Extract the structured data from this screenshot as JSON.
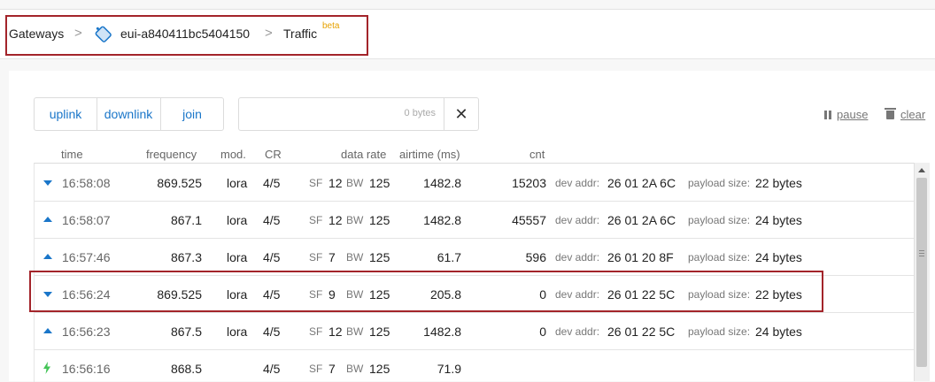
{
  "breadcrumb": {
    "gateways": "Gateways",
    "gateway_id": "eui-a840411bc5404150",
    "traffic": "Traffic",
    "beta": "beta",
    "separator": ">"
  },
  "filters": {
    "uplink": "uplink",
    "downlink": "downlink",
    "join": "join",
    "payload_size": "0 bytes",
    "close": "✕"
  },
  "actions": {
    "pause": "pause",
    "clear": "clear"
  },
  "columns": {
    "time": "time",
    "frequency": "frequency",
    "mod": "mod.",
    "cr": "CR",
    "data_rate": "data rate",
    "airtime": "airtime (ms)",
    "cnt": "cnt"
  },
  "labels": {
    "sf": "SF",
    "bw": "BW",
    "dev_addr": "dev addr:",
    "payload_size": "payload size:"
  },
  "rows": [
    {
      "direction": "downlink",
      "time": "16:58:08",
      "frequency": "869.525",
      "mod": "lora",
      "cr": "4/5",
      "sf": "12",
      "bw": "125",
      "airtime": "1482.8",
      "cnt": "15203",
      "dev_addr": "26 01 2A 6C",
      "payload": "22 bytes"
    },
    {
      "direction": "uplink",
      "time": "16:58:07",
      "frequency": "867.1",
      "mod": "lora",
      "cr": "4/5",
      "sf": "12",
      "bw": "125",
      "airtime": "1482.8",
      "cnt": "45557",
      "dev_addr": "26 01 2A 6C",
      "payload": "24 bytes"
    },
    {
      "direction": "uplink",
      "time": "16:57:46",
      "frequency": "867.3",
      "mod": "lora",
      "cr": "4/5",
      "sf": "7",
      "bw": "125",
      "airtime": "61.7",
      "cnt": "596",
      "dev_addr": "26 01 20 8F",
      "payload": "24 bytes"
    },
    {
      "direction": "downlink",
      "time": "16:56:24",
      "frequency": "869.525",
      "mod": "lora",
      "cr": "4/5",
      "sf": "9",
      "bw": "125",
      "airtime": "205.8",
      "cnt": "0",
      "dev_addr": "26 01 22 5C",
      "payload": "22 bytes"
    },
    {
      "direction": "uplink",
      "time": "16:56:23",
      "frequency": "867.5",
      "mod": "lora",
      "cr": "4/5",
      "sf": "12",
      "bw": "125",
      "airtime": "1482.8",
      "cnt": "0",
      "dev_addr": "26 01 22 5C",
      "payload": "24 bytes"
    },
    {
      "direction": "join",
      "time": "16:56:16",
      "frequency": "868.5",
      "mod": "",
      "cr": "4/5",
      "sf": "7",
      "bw": "125",
      "airtime": "71.9",
      "cnt": "",
      "dev_addr": "",
      "payload": ""
    }
  ],
  "colors": {
    "accent": "#1a76c9",
    "highlight_border": "#a3242a",
    "beta": "#e6a100",
    "join_icon": "#44c457"
  }
}
